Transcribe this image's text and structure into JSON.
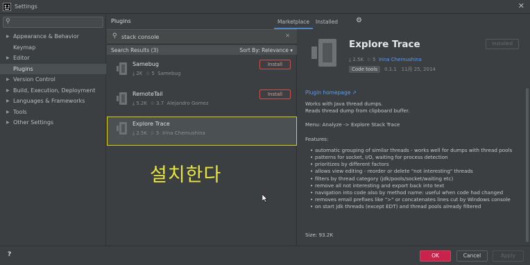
{
  "window": {
    "title": "Settings",
    "app_icon": "IJ",
    "close": "✕"
  },
  "sidebar": {
    "search_placeholder": "",
    "items": [
      {
        "label": "Appearance & Behavior",
        "expandable": true
      },
      {
        "label": "Keymap",
        "expandable": false
      },
      {
        "label": "Editor",
        "expandable": true
      },
      {
        "label": "Plugins",
        "expandable": false,
        "selected": true
      },
      {
        "label": "Version Control",
        "expandable": true
      },
      {
        "label": "Build, Execution, Deployment",
        "expandable": true
      },
      {
        "label": "Languages & Frameworks",
        "expandable": true
      },
      {
        "label": "Tools",
        "expandable": true
      },
      {
        "label": "Other Settings",
        "expandable": true
      }
    ]
  },
  "plugins_header": {
    "title": "Plugins"
  },
  "tabs": {
    "marketplace": "Marketplace",
    "installed": "Installed",
    "active": "Marketplace"
  },
  "search": {
    "query": "stack console",
    "clear": "✕"
  },
  "results": {
    "count_label": "Search Results (3)",
    "sort_label": "Sort By: Relevance ▾"
  },
  "plugins": [
    {
      "name": "Samebug",
      "downloads": "2K",
      "rating": "5",
      "vendor": "Samebug",
      "install": "Install"
    },
    {
      "name": "RemoteTail",
      "downloads": "5.2K",
      "rating": "3.7",
      "vendor": "Alejandro Gomez",
      "install": "Install"
    },
    {
      "name": "Explore Trace",
      "downloads": "2.5K",
      "rating": "5",
      "vendor": "Irina Chernushina"
    }
  ],
  "annotation": "설치한다",
  "detail": {
    "title": "Explore Trace",
    "installed_button": "Installed",
    "downloads": "2.5K",
    "rating": "5",
    "author": "Irina Chernushina",
    "tag": "Code tools",
    "version": "0.1.1",
    "date": "11月 25, 2014",
    "homepage": "Plugin homepage ↗",
    "desc1": "Works with Java thread dumps.",
    "desc2": "Reads thread dump from clipboard buffer.",
    "menu": "Menu: Analyze -> Explore Stack Trace",
    "features_title": "Features:",
    "features": [
      "automatic grouping of similar threads - works well for dumps with thread pools",
      "patterns for socket, I/O, waiting for process detection",
      "prioritizes by different factors",
      "allows view editing - reorder or delete \"not interesting\" threads",
      "filters by thread category (jdk/pools/socket/waiting etc)",
      "remove all not interesting and export back into text",
      "navigation into code also by method name: useful when code had changed",
      "removes email prefixes like \">\" or concatenates lines cut by Windows console",
      "on start jdk threads (except EDT) and thread pools already filtered"
    ],
    "size": "Size: 93.2K"
  },
  "footer": {
    "help": "?",
    "ok": "OK",
    "cancel": "Cancel",
    "apply": "Apply"
  },
  "colors": {
    "accent": "#4a88c7",
    "ok": "#c8234a",
    "highlight": "#d7d200",
    "link": "#589df6",
    "install": "#c75450"
  }
}
